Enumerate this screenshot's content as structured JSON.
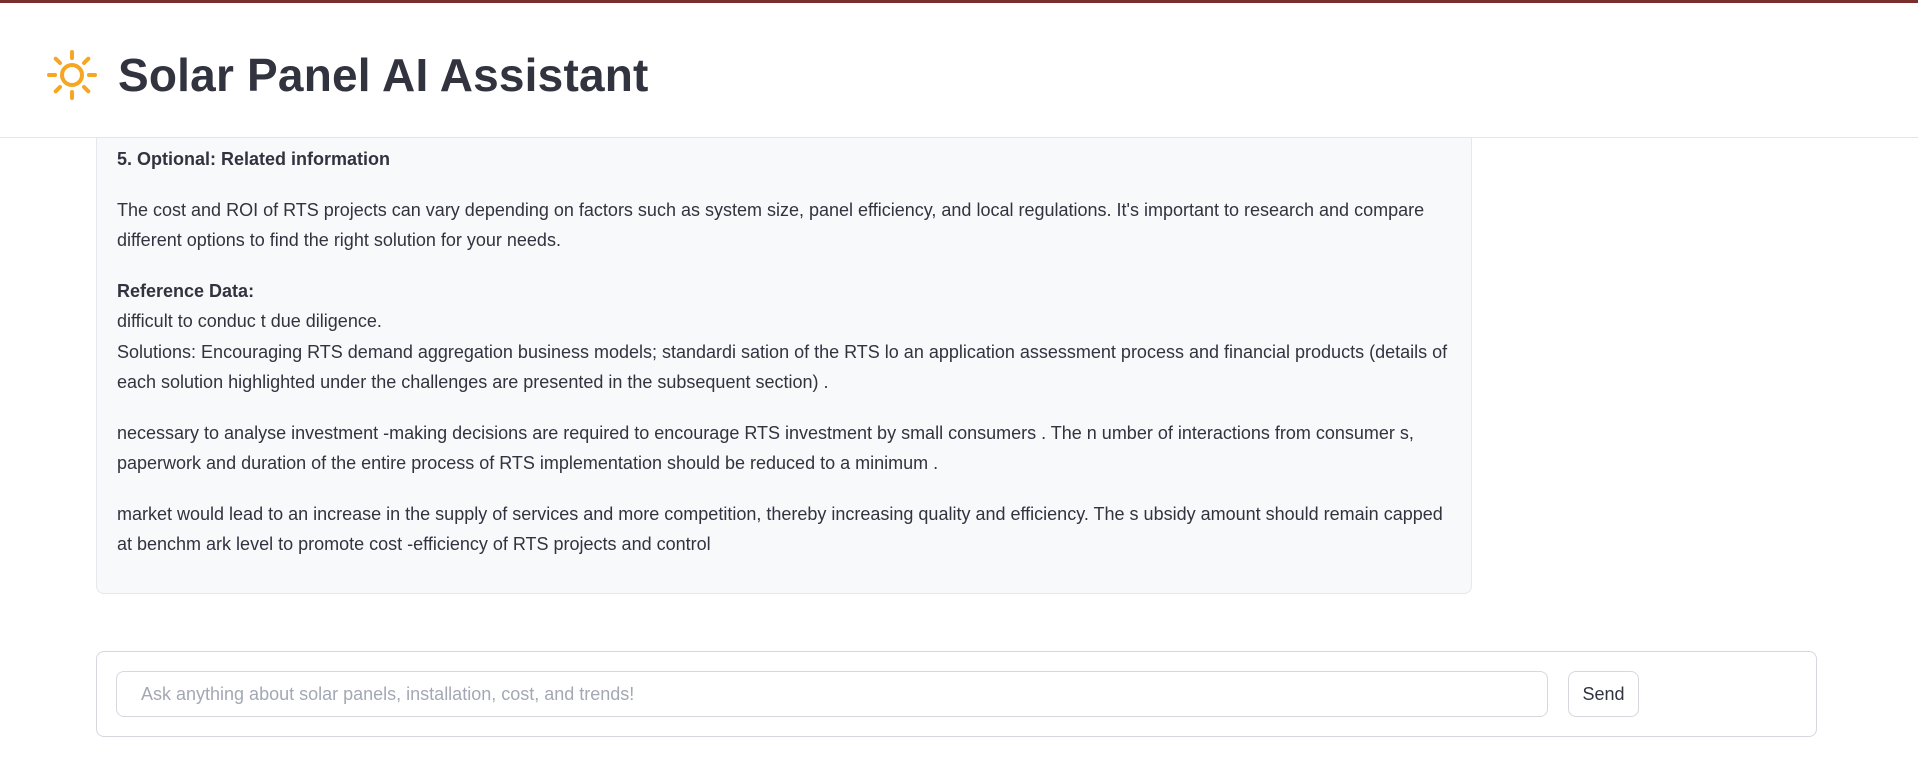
{
  "app": {
    "title": "Solar Panel AI Assistant",
    "icon": "sun-icon",
    "accent_color": "#7a2e2e",
    "icon_color": "#f5a623"
  },
  "message": {
    "section_heading": "5. Optional: Related information",
    "paragraph_1": "The cost and ROI of RTS projects can vary depending on factors such as system size, panel efficiency, and local regulations. It's important to research and compare different options to find the right solution for your needs.",
    "reference_heading": "Reference Data:",
    "reference_line_1": "difficult to conduc t due diligence.",
    "reference_line_2": "Solutions: Encouraging RTS demand aggregation business models; standardi sation of the RTS lo an application assessment process and financial products (details of each solution highlighted under the challenges are presented in the subsequent section) .",
    "paragraph_2": "necessary to analyse investment -making decisions are required to encourage RTS investment by small consumers . The n umber of interactions from consumer s, paperwork and duration of the entire process of RTS implementation should be reduced to a minimum .",
    "paragraph_3": "market would lead to an increase in the supply of services and more competition, thereby increasing quality and efficiency. The s ubsidy amount should remain capped at benchm ark level to promote cost -efficiency of RTS projects and control"
  },
  "chat_input": {
    "placeholder": "Ask anything about solar panels, installation, cost, and trends!",
    "value": ""
  },
  "send_button": {
    "label": "Send"
  }
}
